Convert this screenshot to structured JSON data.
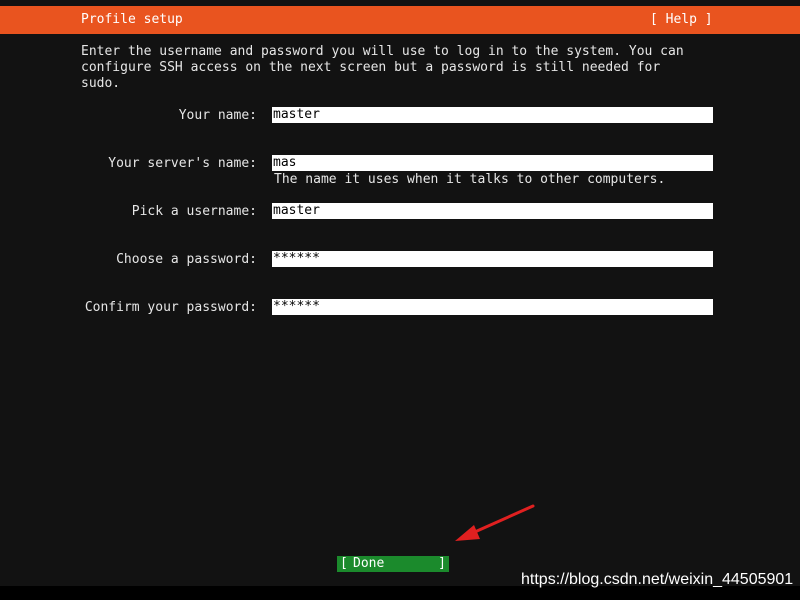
{
  "header": {
    "title": "Profile setup",
    "help_label": "[ Help ]",
    "bg_color": "#e9541f"
  },
  "intro": {
    "text": "Enter the username and password you will use to log in to the system. You can\nconfigure SSH access on the next screen but a password is still needed for\nsudo."
  },
  "form": {
    "fields": [
      {
        "label": "Your name:",
        "value": "master"
      },
      {
        "label": "Your server's name:",
        "value": "mas",
        "hint": "The name it uses when it talks to other computers."
      },
      {
        "label": "Pick a username:",
        "value": "master"
      },
      {
        "label": "Choose a password:",
        "value": "******"
      },
      {
        "label": "Confirm your password:",
        "value": "******"
      }
    ]
  },
  "footer": {
    "done_open": "[",
    "done_label": "Done",
    "done_close": "]",
    "done_color": "#1b8a2c"
  },
  "annotation": {
    "arrow_color": "#e02020",
    "arrow_icon": "red-arrow-icon"
  },
  "watermark": {
    "text": "https://blog.csdn.net/weixin_44505901"
  }
}
